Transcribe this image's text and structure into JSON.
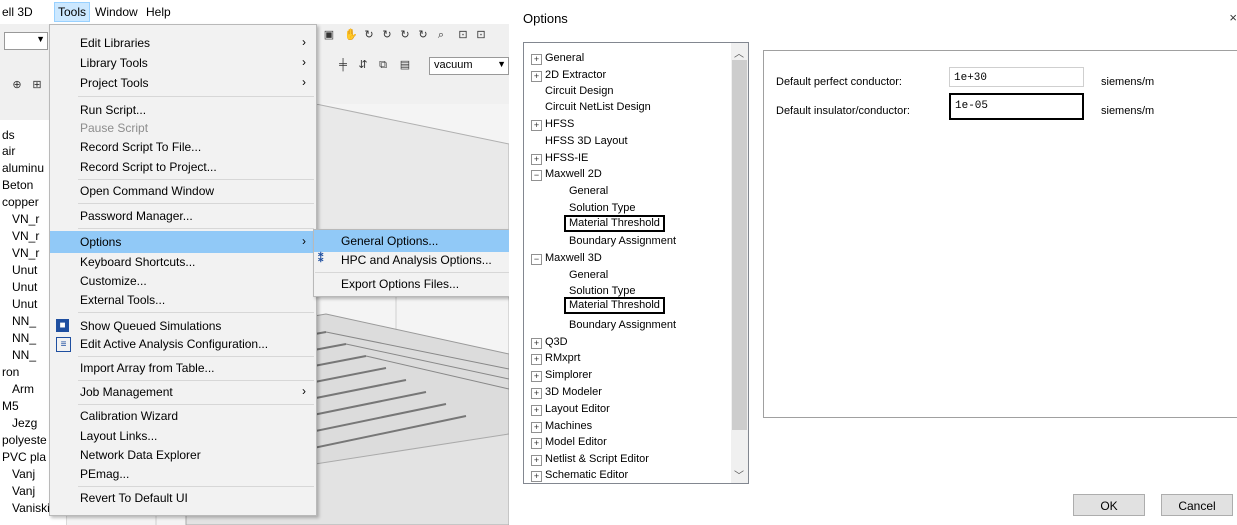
{
  "menubar": {
    "app_partial": "ell 3D",
    "tools": "Tools",
    "window": "Window",
    "help": "Help"
  },
  "toolbar": {
    "material_dropdown": "vacuum"
  },
  "left_tree": {
    "items": [
      "ds",
      "air",
      "aluminu",
      "Beton",
      "copper",
      "VN_r",
      "VN_r",
      "VN_r",
      "Unut",
      "Unut",
      "Unut",
      "NN_",
      "NN_",
      "NN_",
      "ron",
      "Arm",
      "M5",
      "Jezg",
      "polyeste",
      "PVC pla",
      "Vanj",
      "Vanj",
      "Vaniski_dio_Srednji_k"
    ]
  },
  "tools_menu": {
    "items": [
      {
        "label": "Edit Libraries",
        "arrow": "›"
      },
      {
        "label": "Library Tools",
        "arrow": "›"
      },
      {
        "label": "Project Tools",
        "arrow": "›"
      },
      {
        "label": "Run Script..."
      },
      {
        "label": "Pause Script"
      },
      {
        "label": "Record Script To File..."
      },
      {
        "label": "Record Script to Project..."
      },
      {
        "label": "Open Command Window"
      },
      {
        "label": "Password Manager..."
      },
      {
        "label": "Options",
        "arrow": "›"
      },
      {
        "label": "Keyboard Shortcuts..."
      },
      {
        "label": "Customize..."
      },
      {
        "label": "External Tools..."
      },
      {
        "label": "Show Queued Simulations"
      },
      {
        "label": "Edit Active Analysis Configuration..."
      },
      {
        "label": "Import Array from Table..."
      },
      {
        "label": "Job Management",
        "arrow": "›"
      },
      {
        "label": "Calibration Wizard"
      },
      {
        "label": "Layout Links..."
      },
      {
        "label": "Network Data Explorer"
      },
      {
        "label": "PEmag..."
      },
      {
        "label": "Revert To Default UI"
      }
    ]
  },
  "options_submenu": {
    "items": [
      {
        "label": "General Options..."
      },
      {
        "label": "HPC and Analysis Options..."
      },
      {
        "label": "Export Options Files..."
      }
    ]
  },
  "options_dialog": {
    "title": "Options",
    "close": "×",
    "tree": [
      {
        "label": "General",
        "exp": "+"
      },
      {
        "label": "2D Extractor",
        "exp": "+"
      },
      {
        "label": "Circuit Design"
      },
      {
        "label": "Circuit NetList Design"
      },
      {
        "label": "HFSS",
        "exp": "+"
      },
      {
        "label": "HFSS 3D Layout"
      },
      {
        "label": "HFSS-IE",
        "exp": "+"
      },
      {
        "label": "Maxwell 2D",
        "exp": "−"
      },
      {
        "label": "General"
      },
      {
        "label": "Solution Type"
      },
      {
        "label": "Material Threshold"
      },
      {
        "label": "Boundary Assignment"
      },
      {
        "label": "Maxwell 3D",
        "exp": "−"
      },
      {
        "label": "General"
      },
      {
        "label": "Solution Type"
      },
      {
        "label": "Material Threshold"
      },
      {
        "label": "Boundary Assignment"
      },
      {
        "label": "Q3D",
        "exp": "+"
      },
      {
        "label": "RMxprt",
        "exp": "+"
      },
      {
        "label": "Simplorer",
        "exp": "+"
      },
      {
        "label": "3D Modeler",
        "exp": "+"
      },
      {
        "label": "Layout Editor",
        "exp": "+"
      },
      {
        "label": "Machines",
        "exp": "+"
      },
      {
        "label": "Model Editor",
        "exp": "+"
      },
      {
        "label": "Netlist & Script Editor",
        "exp": "+"
      },
      {
        "label": "Schematic Editor",
        "exp": "+"
      }
    ],
    "fields": [
      {
        "label": "Default perfect conductor:",
        "value": "1e+30",
        "unit": "siemens/m"
      },
      {
        "label": "Default insulator/conductor:",
        "value": "1e-05",
        "unit": "siemens/m"
      }
    ],
    "ok": "OK",
    "cancel": "Cancel"
  }
}
